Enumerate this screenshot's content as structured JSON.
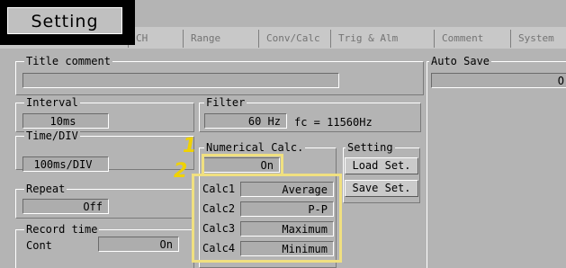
{
  "tabs": [
    "Setting",
    "CH",
    "Range",
    "Conv/Calc",
    "Trig & Alm",
    "Comment",
    "System"
  ],
  "title_comment": {
    "label": "Title comment"
  },
  "auto_save": {
    "label": "Auto Save",
    "value": "O"
  },
  "interval": {
    "label": "Interval",
    "value": "10ms"
  },
  "filter": {
    "label": "Filter",
    "value": "60 Hz",
    "fc": "fc = 11560Hz"
  },
  "time_div": {
    "label": "Time/DIV",
    "value": "100ms/DIV"
  },
  "repeat": {
    "label": "Repeat",
    "value": "Off"
  },
  "record_time": {
    "label": "Record time",
    "mode": "Cont",
    "value": "On"
  },
  "numerical_calc": {
    "label": "Numerical Calc.",
    "value": "On",
    "rows": [
      {
        "label": "Calc1",
        "value": "Average"
      },
      {
        "label": "Calc2",
        "value": "P-P"
      },
      {
        "label": "Calc3",
        "value": "Maximum"
      },
      {
        "label": "Calc4",
        "value": "Minimum"
      }
    ]
  },
  "setting_file": {
    "label": "Setting",
    "load": "Load Set.",
    "save": "Save Set."
  },
  "annotations": [
    "1",
    "2"
  ],
  "colors": {
    "panel": "#b4b4b4",
    "tab_bar": "#c8c8c8",
    "field": "#adadad",
    "highlight": "#f0e080",
    "marker": "#f0d200"
  }
}
